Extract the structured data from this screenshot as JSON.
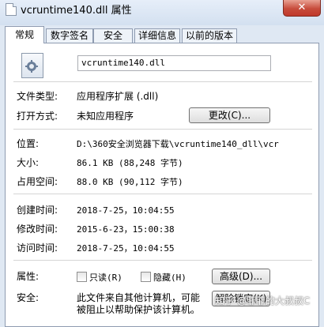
{
  "window": {
    "title": "vcruntime140.dll 属性",
    "close": "✕"
  },
  "tabs": [
    "常规",
    "数字签名",
    "安全",
    "详细信息",
    "以前的版本"
  ],
  "file": {
    "name": "vcruntime140.dll",
    "icon": "dll-file-gear-icon"
  },
  "rows": {
    "type_label": "文件类型:",
    "type_value": "应用程序扩展 (.dll)",
    "open_label": "打开方式:",
    "open_value": "未知应用程序",
    "change_button": "更改(C)...",
    "location_label": "位置:",
    "location_value": "D:\\360安全浏览器下载\\vcruntime140_dll\\vcr",
    "size_label": "大小:",
    "size_value": "86.1 KB (88,248 字节)",
    "disk_label": "占用空间:",
    "disk_value": "88.0 KB (90,112 字节)",
    "created_label": "创建时间:",
    "created_value": "2018-7-25，10:04:55",
    "modified_label": "修改时间:",
    "modified_value": "2015-6-23，15:00:38",
    "accessed_label": "访问时间:",
    "accessed_value": "2018-7-25，10:04:55",
    "attr_label": "属性:",
    "readonly_label": "只读(R)",
    "hidden_label": "隐藏(H)",
    "advanced_button": "高级(D)...",
    "security_label": "安全:",
    "security_text_1": "此文件来自其他计算机，可能",
    "security_text_2": "被阻止以帮助保护该计算机。",
    "unblock_button": "解除锁定(K)"
  },
  "watermark": "知乎 @菲菲的大叔叔C"
}
